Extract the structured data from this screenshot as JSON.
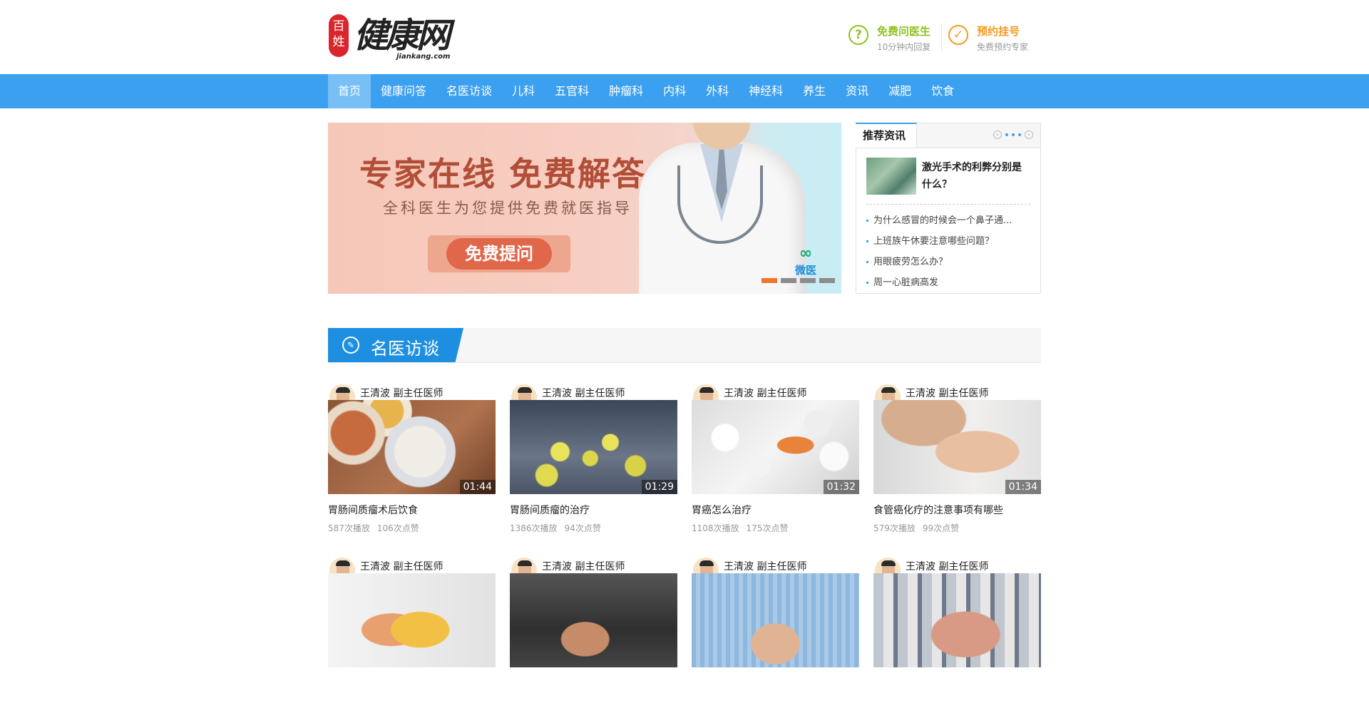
{
  "logo": {
    "seal_text": "百姓",
    "brand": "健康网",
    "domain": "jiankang.com"
  },
  "header_services": {
    "ask": {
      "icon": "question-circle-icon",
      "title": "免费问医生",
      "subtitle": "10分钟内回复"
    },
    "book": {
      "icon": "check-circle-icon",
      "title": "预约挂号",
      "subtitle": "免费预约专家"
    }
  },
  "nav": {
    "items": [
      {
        "label": "首页",
        "active": true
      },
      {
        "label": "健康问答"
      },
      {
        "label": "名医访谈"
      },
      {
        "label": "儿科"
      },
      {
        "label": "五官科"
      },
      {
        "label": "肿瘤科"
      },
      {
        "label": "内科"
      },
      {
        "label": "外科"
      },
      {
        "label": "神经科"
      },
      {
        "label": "养生"
      },
      {
        "label": "资讯"
      },
      {
        "label": "减肥"
      },
      {
        "label": "饮食"
      }
    ]
  },
  "banner": {
    "headline": "专家在线  免费解答",
    "subline": "全科医生为您提供免费就医指导",
    "button": "免费提问",
    "partner": "微医",
    "slides": 4,
    "active_slide": 1
  },
  "recommend": {
    "tab": "推荐资讯",
    "feature_title": "激光手术的利弊分别是什么？",
    "items": [
      "为什么感冒的时候会一个鼻子通...",
      "上班族午休要注意哪些问题？",
      "用眼疲劳怎么办？",
      "周一心脏病高发"
    ]
  },
  "section": {
    "icon": "pill-icon",
    "title": "名医访谈"
  },
  "videos": [
    {
      "doctor": "王清波 副主任医师",
      "duration": "01:44",
      "title": "胃肠间质瘤术后饮食",
      "plays": "587次播放",
      "likes": "106次点赞"
    },
    {
      "doctor": "王清波 副主任医师",
      "duration": "01:29",
      "title": "胃肠间质瘤的治疗",
      "plays": "1386次播放",
      "likes": "94次点赞"
    },
    {
      "doctor": "王清波 副主任医师",
      "duration": "01:32",
      "title": "胃癌怎么治疗",
      "plays": "1108次播放",
      "likes": "175次点赞"
    },
    {
      "doctor": "王清波 副主任医师",
      "duration": "01:34",
      "title": "食管癌化疗的注意事项有哪些",
      "plays": "579次播放",
      "likes": "99次点赞"
    },
    {
      "doctor": "王清波 副主任医师"
    },
    {
      "doctor": "王清波 副主任医师"
    },
    {
      "doctor": "王清波 副主任医师"
    },
    {
      "doctor": "王清波 副主任医师"
    }
  ]
}
